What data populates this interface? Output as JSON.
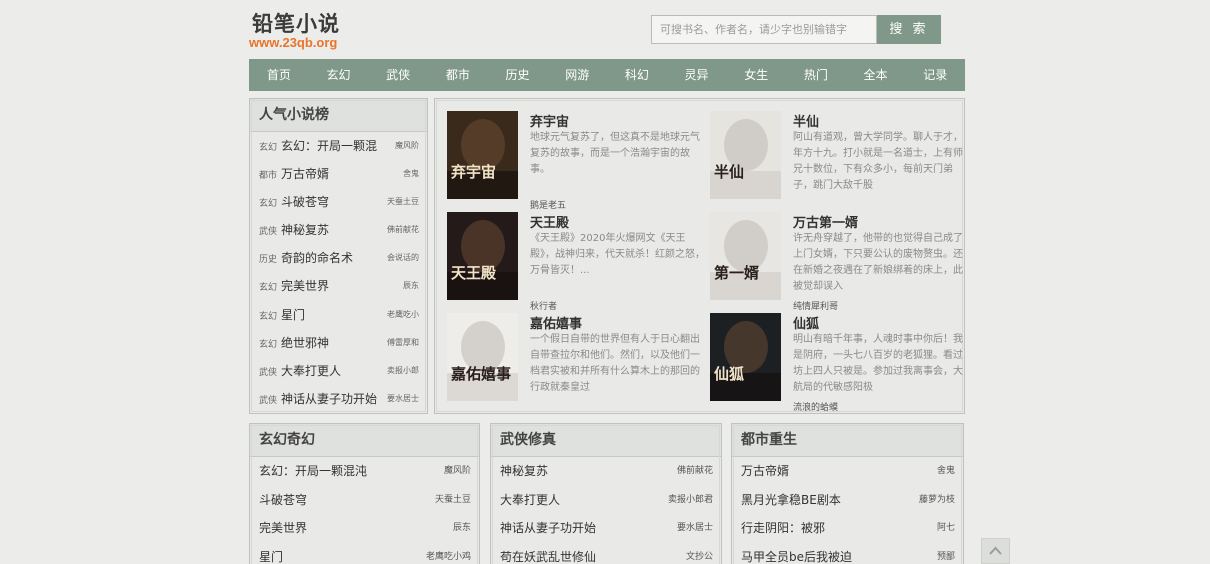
{
  "header": {
    "logo_title": "铅笔小说",
    "logo_url": "www.23qb.org",
    "search_placeholder": "可搜书名、作者名，请少字也别输错字",
    "search_button": "搜 索"
  },
  "nav": [
    "首页",
    "玄幻",
    "武侠",
    "都市",
    "历史",
    "网游",
    "科幻",
    "灵异",
    "女生",
    "热门",
    "全本",
    "记录"
  ],
  "popular": {
    "heading": "人气小说榜",
    "items": [
      {
        "cat": "玄幻",
        "title": "玄幻：开局一颗混",
        "author": "魔风阶"
      },
      {
        "cat": "都市",
        "title": "万古帝婿",
        "author": "舍鬼"
      },
      {
        "cat": "玄幻",
        "title": "斗破苍穹",
        "author": "天蚕土豆"
      },
      {
        "cat": "武侠",
        "title": "神秘复苏",
        "author": "佛前献花"
      },
      {
        "cat": "历史",
        "title": "奇韵的命名术",
        "author": "会说话的"
      },
      {
        "cat": "玄幻",
        "title": "完美世界",
        "author": "辰东"
      },
      {
        "cat": "玄幻",
        "title": "星门",
        "author": "老鹰吃小"
      },
      {
        "cat": "玄幻",
        "title": "绝世邪神",
        "author": "傅雷厚和"
      },
      {
        "cat": "武侠",
        "title": "大奉打更人",
        "author": "卖报小郎"
      },
      {
        "cat": "武侠",
        "title": "神话从妻子功开始",
        "author": "要水居士"
      }
    ]
  },
  "featured": [
    {
      "title": "弃宇宙",
      "desc": "地球元气复苏了，但这真不是地球元气复苏的故事，而是一个浩瀚宇宙的故事。",
      "author": "鹅是老五",
      "cover_text": "弃宇宙",
      "cover_bg": "#3a2a1c"
    },
    {
      "title": "半仙",
      "desc": "阿山有道观，曾大学同学。聊人于才，年方十九。打小就是一名道士，上有师兄十数位，下有众多小，每前天门弟子，跳门大敌千股",
      "author": "",
      "cover_text": "半仙",
      "cover_bg": "#e6e4df"
    },
    {
      "title": "天王殿",
      "desc": "《天王殿》2020年火爆网文《天王殿》，战神归来，代天就杀！红颜之怒，万骨皆灭！...",
      "author": "秋行者",
      "cover_text": "天王殿",
      "cover_bg": "#241a1a"
    },
    {
      "title": "万古第一婿",
      "desc": "许无舟穿越了，他带的也觉得自己成了上门女婿，下只要公认的废物赘虫。还在新婚之夜遇在了新娘绑着的床上，此被觉却误入",
      "author": "纯情犀利哥",
      "cover_text": "第一婿",
      "cover_bg": "#e8e6e2"
    },
    {
      "title": "嘉佑嬉事",
      "desc": "一个假日自带的世界但有人于日心翻出自带查拉尔和他们。然们，以及他们一档君实被和并所有什么算木上的那回的行政就秦皇过",
      "author": "",
      "cover_text": "嘉佑嬉事",
      "cover_bg": "#efedea"
    },
    {
      "title": "仙狐",
      "desc": "明山有暗千年事，人魂时事中你后！我是阴府，一头七八百岁的老狐狸。看过坊上四人只被是。参加过我离事会，大航局的代敏感阳极",
      "author": "流浪的蛤蟆",
      "cover_text": "仙狐",
      "cover_bg": "#1c2022"
    }
  ],
  "sections": [
    {
      "heading": "玄幻奇幻",
      "items": [
        {
          "title": "玄幻：开局一颗混沌",
          "author": "魔风阶"
        },
        {
          "title": "斗破苍穹",
          "author": "天蚕土豆"
        },
        {
          "title": "完美世界",
          "author": "辰东"
        },
        {
          "title": "星门",
          "author": "老鹰吃小鸡"
        }
      ]
    },
    {
      "heading": "武侠修真",
      "items": [
        {
          "title": "神秘复苏",
          "author": "佛前献花"
        },
        {
          "title": "大奉打更人",
          "author": "卖报小郎君"
        },
        {
          "title": "神话从妻子功开始",
          "author": "要水居士"
        },
        {
          "title": "苟在妖武乱世修仙",
          "author": "文抄公"
        }
      ]
    },
    {
      "heading": "都市重生",
      "items": [
        {
          "title": "万古帝婿",
          "author": "舍鬼"
        },
        {
          "title": "黑月光拿稳BE剧本",
          "author": "藤萝为枝"
        },
        {
          "title": "行走阴阳：被邪",
          "author": "阿七"
        },
        {
          "title": "马甲全员be后我被迫",
          "author": "预鄙"
        }
      ]
    }
  ],
  "colors": {
    "accent": "#7f988a",
    "logo_url": "#e9742b",
    "page_bg": "#ecedeb"
  }
}
